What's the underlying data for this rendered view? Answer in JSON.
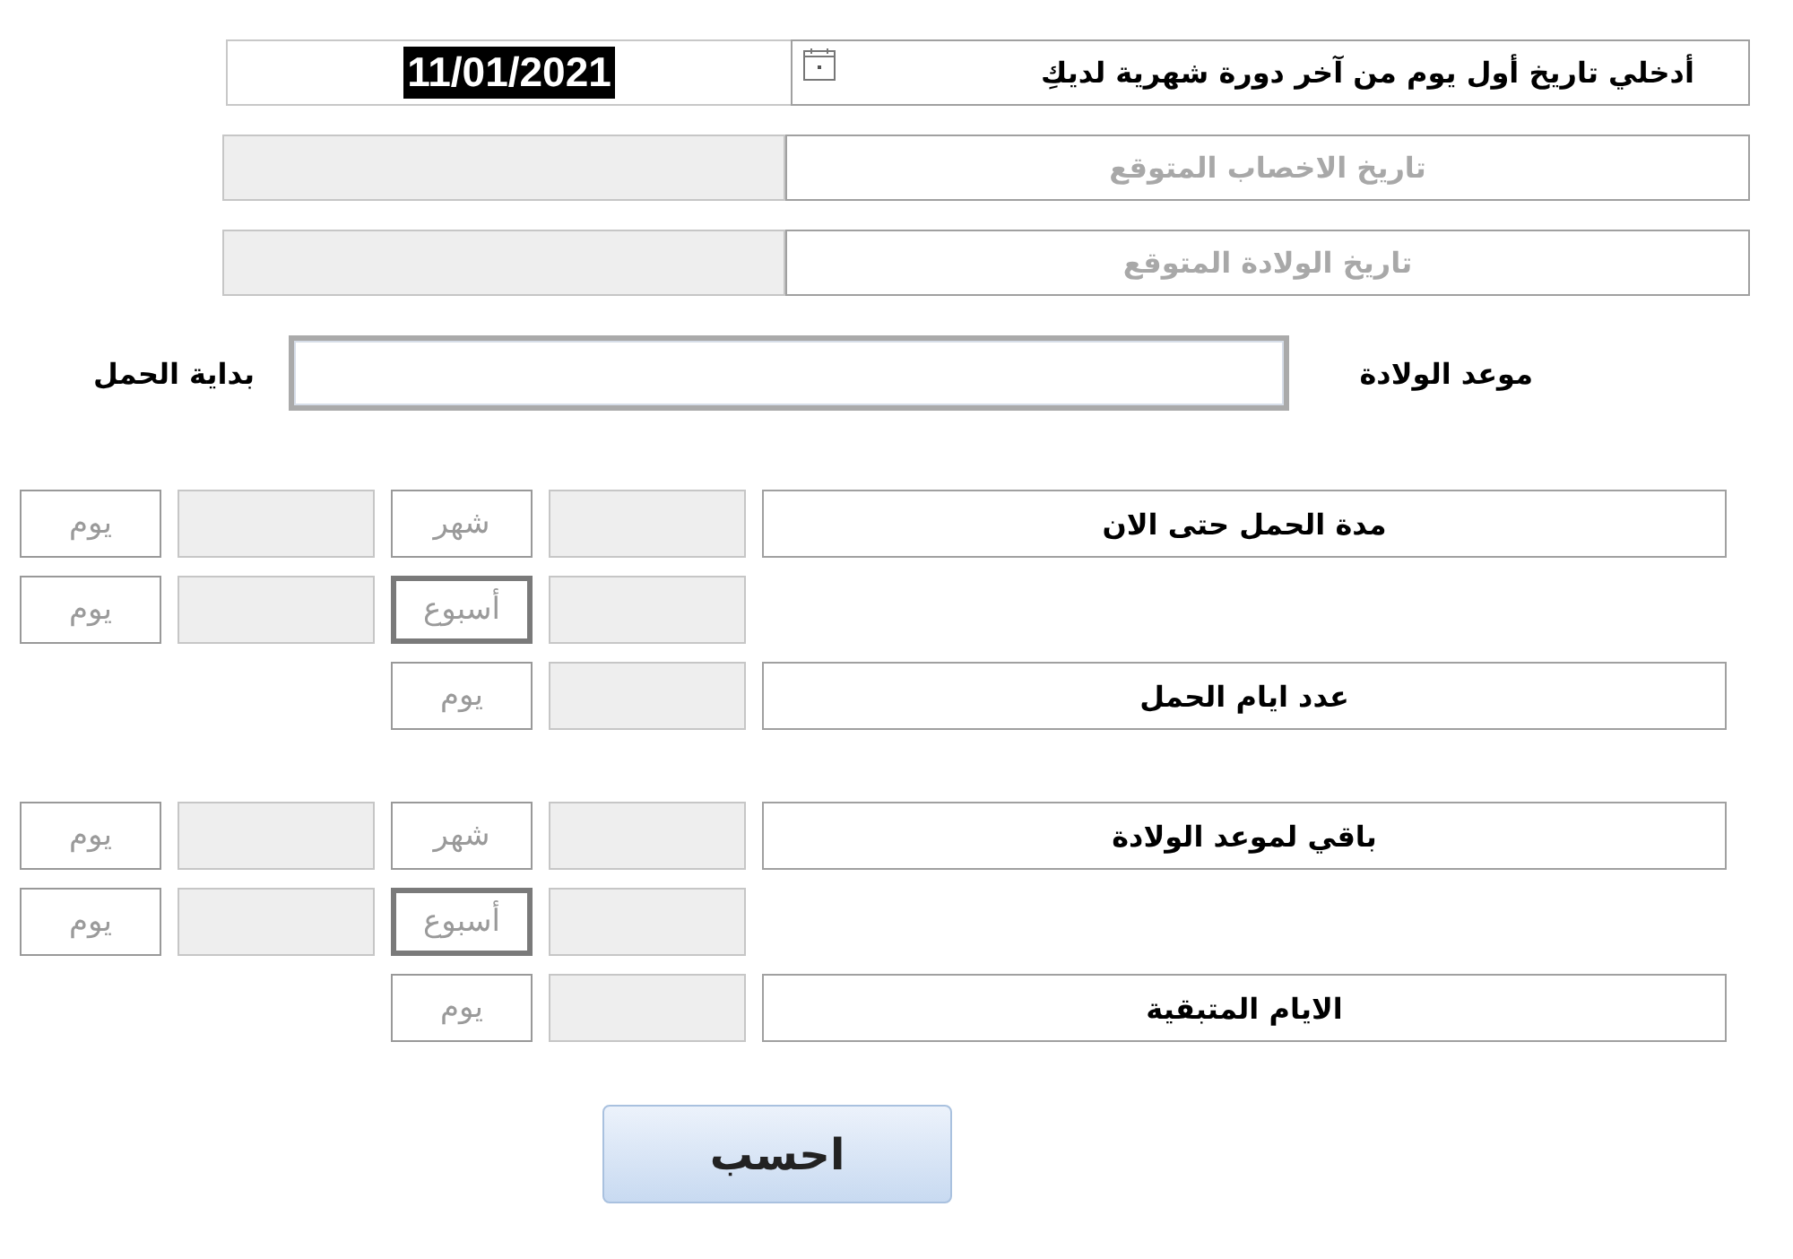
{
  "date_fields": [
    {
      "kind": "input",
      "label": "أدخلي تاريخ أول يوم من آخر دورة شهرية لديكِ",
      "value": "11/01/2021",
      "value_selected": true
    },
    {
      "kind": "output",
      "label": "تاريخ الاخصاب المتوقع"
    },
    {
      "kind": "output",
      "label": "تاريخ الولادة المتوقع"
    }
  ],
  "due_date": {
    "label": "موعد الولادة",
    "end_label": "بداية الحمل"
  },
  "sections": [
    {
      "rows": [
        {
          "label": "مدة الحمل حتى الان",
          "units": [
            {
              "text": "شهر",
              "highlighted": false
            },
            {
              "text": "يوم",
              "highlighted": false
            }
          ]
        },
        {
          "units": [
            {
              "text": "أسبوع",
              "highlighted": true
            },
            {
              "text": "يوم",
              "highlighted": false
            }
          ]
        },
        {
          "label": "عدد ايام الحمل",
          "units": [
            {
              "text": "يوم",
              "highlighted": false
            }
          ]
        }
      ]
    },
    {
      "rows": [
        {
          "label": "باقي لموعد الولادة",
          "units": [
            {
              "text": "شهر",
              "highlighted": false
            },
            {
              "text": "يوم",
              "highlighted": false
            }
          ]
        },
        {
          "units": [
            {
              "text": "أسبوع",
              "highlighted": true
            },
            {
              "text": "يوم",
              "highlighted": false
            }
          ]
        },
        {
          "label": "الايام المتبقية",
          "units": [
            {
              "text": "يوم",
              "highlighted": false
            }
          ]
        }
      ]
    }
  ],
  "calculate_button": "احسب"
}
